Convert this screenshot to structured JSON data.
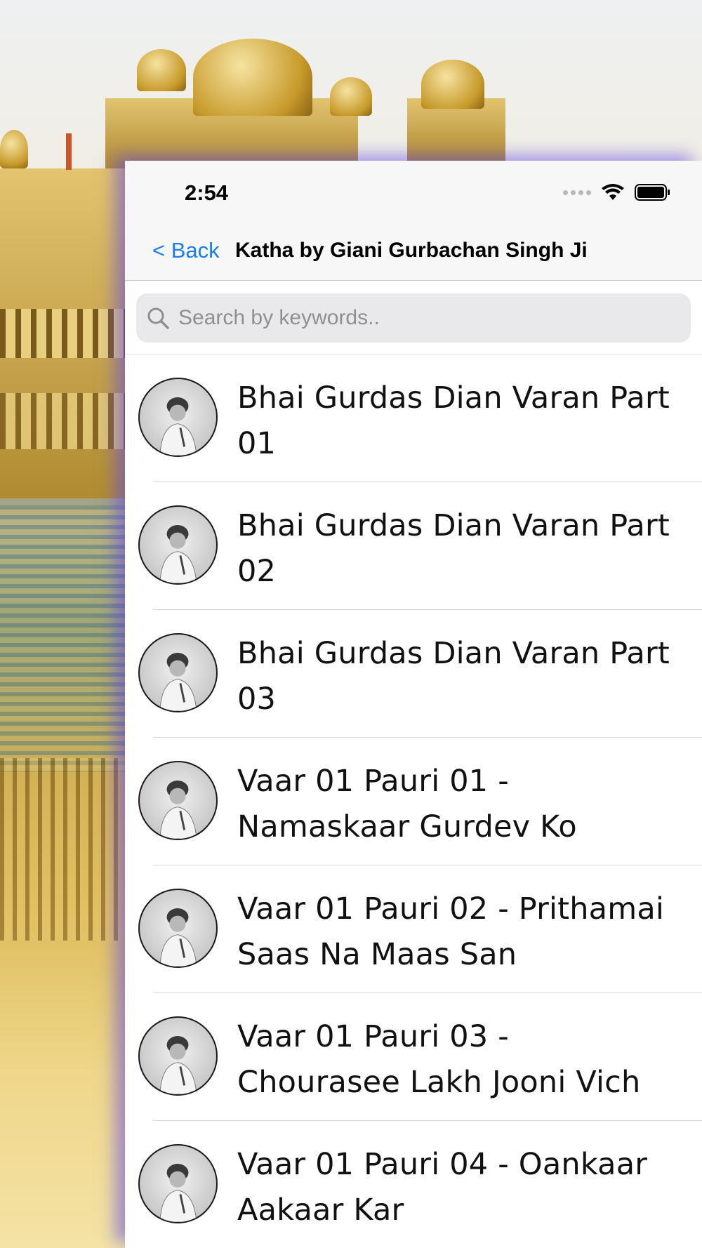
{
  "status_bar": {
    "time": "2:54"
  },
  "nav": {
    "back_label": "< Back",
    "title": "Katha by Giani Gurbachan Singh Ji"
  },
  "search": {
    "placeholder": "Search by keywords..",
    "value": ""
  },
  "items": [
    {
      "title": "Bhai Gurdas Dian Varan Part 01",
      "avatar_icon": "speaker-portrait-icon"
    },
    {
      "title": "Bhai Gurdas Dian Varan Part 02",
      "avatar_icon": "speaker-portrait-icon"
    },
    {
      "title": "Bhai Gurdas Dian Varan Part 03",
      "avatar_icon": "speaker-portrait-icon"
    },
    {
      "title": "Vaar 01 Pauri 01 - Namaskaar Gurdev Ko",
      "avatar_icon": "speaker-portrait-icon"
    },
    {
      "title": "Vaar 01 Pauri 02 - Prithamai Saas Na Maas San",
      "avatar_icon": "speaker-portrait-icon"
    },
    {
      "title": "Vaar 01 Pauri 03 - Chourasee Lakh Jooni Vich",
      "avatar_icon": "speaker-portrait-icon"
    },
    {
      "title": "Vaar 01 Pauri 04 - Oankaar Aakaar Kar",
      "avatar_icon": "speaker-portrait-icon"
    }
  ],
  "colors": {
    "accent": "#1c7cf0",
    "panel_shadow": "#5f46e6"
  }
}
